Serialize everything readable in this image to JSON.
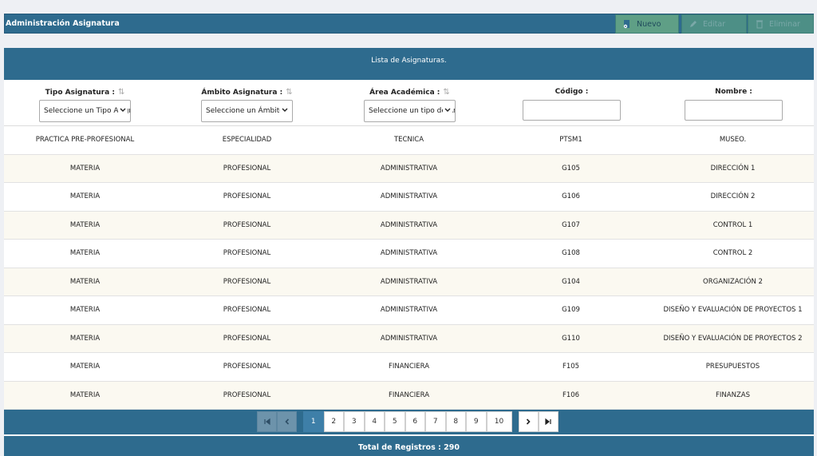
{
  "header": {
    "title": "Administración Asignatura",
    "buttons": {
      "nuevo": "Nuevo",
      "editar": "Editar",
      "eliminar": "Eliminar"
    }
  },
  "panel": {
    "title": "Lista de Asignaturas."
  },
  "filters": {
    "tipo": {
      "label": "Tipo Asignatura :",
      "value": "Seleccione un Tipo Asignatura"
    },
    "ambito": {
      "label": "Ámbito Asignatura :",
      "value": "Seleccione un Ámbito"
    },
    "area": {
      "label": "Área Académica :",
      "value": "Seleccione un tipo de Área"
    },
    "codigo": {
      "label": "Código :",
      "value": ""
    },
    "nombre": {
      "label": "Nombre :",
      "value": ""
    }
  },
  "rows": [
    [
      "PRACTICA PRE-PROFESIONAL",
      "ESPECIALIDAD",
      "TECNICA",
      "PTSM1",
      "MUSEO."
    ],
    [
      "MATERIA",
      "PROFESIONAL",
      "ADMINISTRATIVA",
      "G105",
      "DIRECCIÓN 1"
    ],
    [
      "MATERIA",
      "PROFESIONAL",
      "ADMINISTRATIVA",
      "G106",
      "DIRECCIÓN 2"
    ],
    [
      "MATERIA",
      "PROFESIONAL",
      "ADMINISTRATIVA",
      "G107",
      "CONTROL 1"
    ],
    [
      "MATERIA",
      "PROFESIONAL",
      "ADMINISTRATIVA",
      "G108",
      "CONTROL 2"
    ],
    [
      "MATERIA",
      "PROFESIONAL",
      "ADMINISTRATIVA",
      "G104",
      "ORGANIZACIÓN 2"
    ],
    [
      "MATERIA",
      "PROFESIONAL",
      "ADMINISTRATIVA",
      "G109",
      "DISEÑO Y EVALUACIÓN DE PROYECTOS 1"
    ],
    [
      "MATERIA",
      "PROFESIONAL",
      "ADMINISTRATIVA",
      "G110",
      "DISEÑO Y EVALUACIÓN DE PROYECTOS 2"
    ],
    [
      "MATERIA",
      "PROFESIONAL",
      "FINANCIERA",
      "F105",
      "PRESUPUESTOS"
    ],
    [
      "MATERIA",
      "PROFESIONAL",
      "FINANCIERA",
      "F106",
      "FINANZAS"
    ]
  ],
  "pagination": {
    "pages": [
      "1",
      "2",
      "3",
      "4",
      "5",
      "6",
      "7",
      "8",
      "9",
      "10"
    ],
    "current": "1"
  },
  "footer": {
    "total": "Total de Registros : 290"
  },
  "colors": {
    "primary": "#2e6b8e",
    "row_alt": "#fbf9f1",
    "button_green": "#5f9f86"
  }
}
